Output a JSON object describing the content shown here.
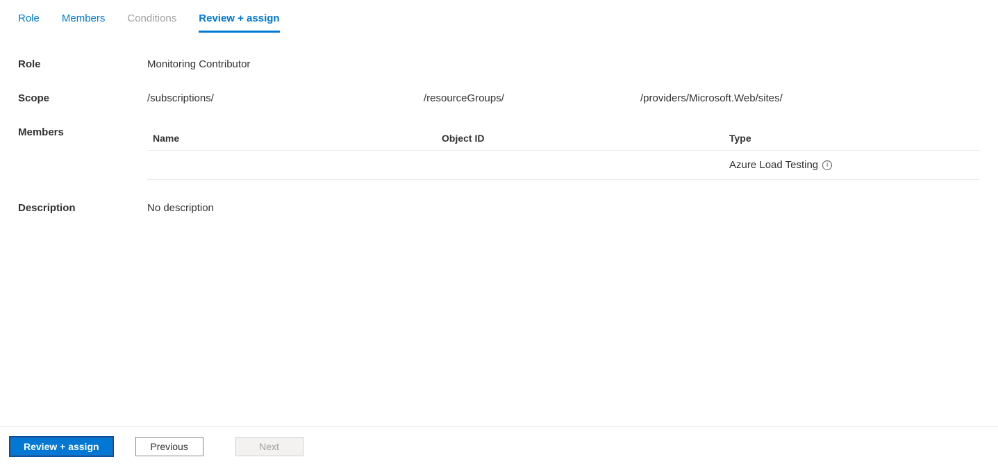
{
  "tabs": {
    "role": "Role",
    "members": "Members",
    "conditions": "Conditions",
    "review": "Review + assign"
  },
  "labels": {
    "role": "Role",
    "scope": "Scope",
    "members": "Members",
    "description": "Description"
  },
  "role_value": "Monitoring Contributor",
  "scope": {
    "part1": "/subscriptions/",
    "part2": "/resourceGroups/",
    "part3": "/providers/Microsoft.Web/sites/"
  },
  "members_table": {
    "headers": {
      "name": "Name",
      "object_id": "Object ID",
      "type": "Type"
    },
    "rows": [
      {
        "name": "",
        "object_id": "",
        "type": "Azure Load Testing"
      }
    ]
  },
  "description_value": "No description",
  "footer": {
    "review": "Review + assign",
    "previous": "Previous",
    "next": "Next"
  },
  "icons": {
    "info_glyph": "i"
  }
}
